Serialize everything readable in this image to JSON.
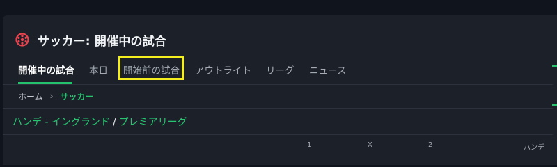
{
  "header": {
    "title": "サッカー: 開催中の試合",
    "icon": "soccer-ball-icon",
    "accent_color": "#e8454f"
  },
  "tabs": [
    {
      "label": "開催中の試合",
      "active": true
    },
    {
      "label": "本日",
      "active": false
    },
    {
      "label": "開始前の試合",
      "active": false,
      "highlighted": true
    },
    {
      "label": "アウトライト",
      "active": false
    },
    {
      "label": "リーグ",
      "active": false
    },
    {
      "label": "ニュース",
      "active": false
    }
  ],
  "breadcrumb": {
    "home": "ホーム",
    "separator": "›",
    "current": "サッカー"
  },
  "league": {
    "country": "ハンデ - イングランド",
    "separator": "/",
    "name": "プレミアリーグ"
  },
  "columns": [
    "1",
    "X",
    "2",
    "ハンデ"
  ],
  "colors": {
    "green": "#25c26e",
    "highlight": "#f5ee1e",
    "background": "#1b2029"
  }
}
